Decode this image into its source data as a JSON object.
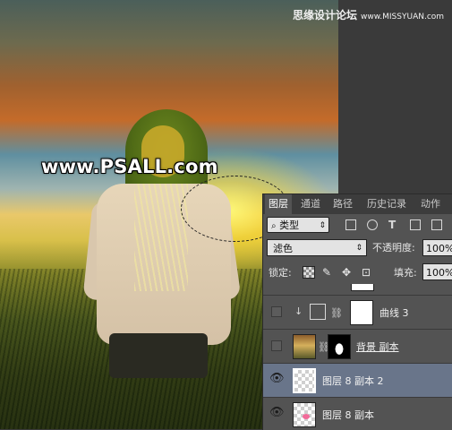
{
  "canvas": {
    "watermark_text": "www.PSALL.com"
  },
  "site_mark": {
    "name": "思缘设计论坛",
    "url": "www.MISSYUAN.com"
  },
  "layers_panel": {
    "tabs": [
      {
        "label": "图层",
        "active": true
      },
      {
        "label": "通道",
        "active": false
      },
      {
        "label": "路径",
        "active": false
      },
      {
        "label": "历史记录",
        "active": false
      },
      {
        "label": "动作",
        "active": false
      }
    ],
    "filter": {
      "kind_label": "类型",
      "icons": [
        "image-filter-icon",
        "adjustment-filter-icon",
        "type-filter-icon",
        "shape-filter-icon",
        "smart-object-filter-icon"
      ]
    },
    "blend_mode": "滤色",
    "opacity_label": "不透明度:",
    "opacity_value": "100%",
    "lock_label": "锁定:",
    "fill_label": "填充:",
    "fill_value": "100%",
    "layers": [
      {
        "name": "",
        "visible": false,
        "type": "partial"
      },
      {
        "name": "曲线 3",
        "visible": false,
        "type": "curves"
      },
      {
        "name": "背景 副本",
        "visible": false,
        "type": "photo-mask"
      },
      {
        "name": "图层 8 副本 2",
        "visible": true,
        "type": "transparent",
        "selected": true
      },
      {
        "name": "图层 8 副本",
        "visible": true,
        "type": "transparent"
      }
    ]
  }
}
